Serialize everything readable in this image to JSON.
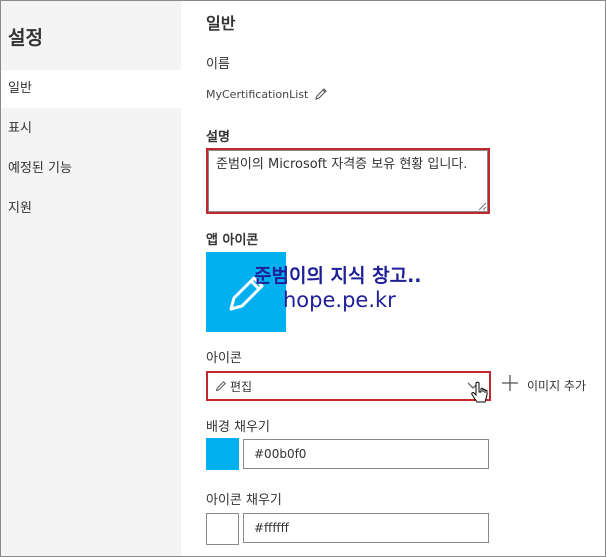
{
  "sidebar": {
    "title": "설정",
    "items": [
      {
        "label": "일반",
        "active": true
      },
      {
        "label": "표시",
        "active": false
      },
      {
        "label": "예정된 기능",
        "active": false
      },
      {
        "label": "지원",
        "active": false
      }
    ]
  },
  "main": {
    "section_title": "일반",
    "name": {
      "label": "이름",
      "value": "MyCertificationList"
    },
    "description": {
      "label": "설명",
      "value": "준범이의 Microsoft 자격증 보유 현황 입니다."
    },
    "app_icon": {
      "label": "앱 아이콘",
      "tile_color": "#00b0f0"
    },
    "watermark": {
      "line1": "준범이의 지식 창고..",
      "line2": "hope.pe.kr",
      "color": "#1f1f9a"
    },
    "icon": {
      "label": "아이콘",
      "dropdown_value": "편집",
      "add_image_label": "이미지 추가"
    },
    "background_fill": {
      "label": "배경 채우기",
      "value": "#00b0f0",
      "swatch_color": "#00b0f0"
    },
    "icon_fill": {
      "label": "아이콘 채우기",
      "value": "#ffffff",
      "swatch_color": "#ffffff"
    }
  },
  "colors": {
    "highlight": "#c4282f",
    "accent": "#00b0f0"
  }
}
